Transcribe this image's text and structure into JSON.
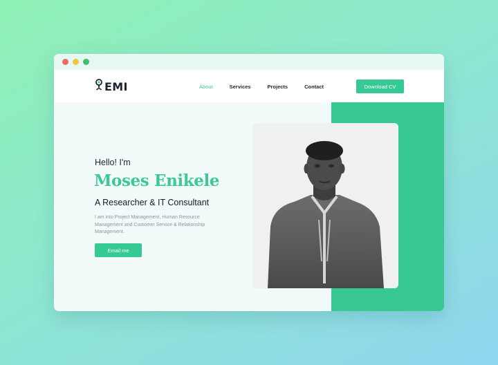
{
  "window": {
    "controls": [
      "close",
      "minimize",
      "maximize"
    ]
  },
  "header": {
    "logo_text": "EMI",
    "logo_icon": "microphone-icon",
    "nav": [
      {
        "label": "About",
        "active": true
      },
      {
        "label": "Services",
        "active": false
      },
      {
        "label": "Projects",
        "active": false
      },
      {
        "label": "Contact",
        "active": false
      }
    ],
    "cta_label": "Download CV"
  },
  "hero": {
    "greeting": "Hello! I'm",
    "name": "Moses Enikele",
    "role": "A Researcher & IT Consultant",
    "description": "I am into Project Management, Human Resource Management and Customer Service & Relationship Management.",
    "button_label": "Email me"
  },
  "colors": {
    "accent": "#36c993",
    "background_gradient_start": "#8ff0b4",
    "background_gradient_end": "#8fd6f0",
    "text_dark": "#1d2430"
  }
}
